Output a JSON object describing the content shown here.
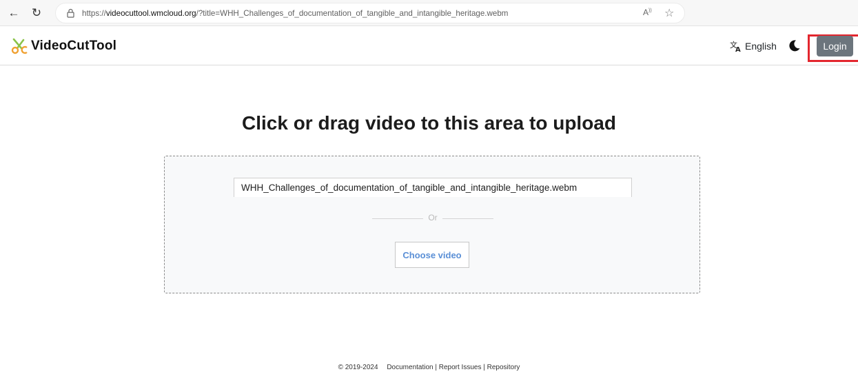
{
  "browser": {
    "url_prefix": "https://",
    "url_host": "videocuttool.wmcloud.org",
    "url_rest": "/?title=WHH_Challenges_of_documentation_of_tangible_and_intangible_heritage.webm",
    "icons": [
      "back-icon",
      "reload-icon",
      "lock-icon",
      "read-aloud-icon",
      "favorite-star-icon"
    ]
  },
  "header": {
    "logo_text": "VideoCutTool",
    "language_label": "English",
    "login_label": "Login",
    "icons": [
      "scissors-logo-icon",
      "translate-icon",
      "moon-icon"
    ]
  },
  "main": {
    "title": "Click or drag video to this area to upload",
    "title_input_value": "WHH_Challenges_of_documentation_of_tangible_and_intangible_heritage.webm",
    "or_label": "Or",
    "choose_video_label": "Choose video"
  },
  "footer": {
    "copyright": "© 2019-2024",
    "documentation": "Documentation",
    "sep1": " | ",
    "report_issues": "Report Issues",
    "sep2": " | ",
    "repository": "Repository"
  },
  "colors": {
    "login_bg": "#6c757d",
    "highlight_border": "#e3262e",
    "choose_video_text": "#5a8fd6",
    "logo_green": "#8bc34a",
    "logo_orange": "#f0a030"
  }
}
